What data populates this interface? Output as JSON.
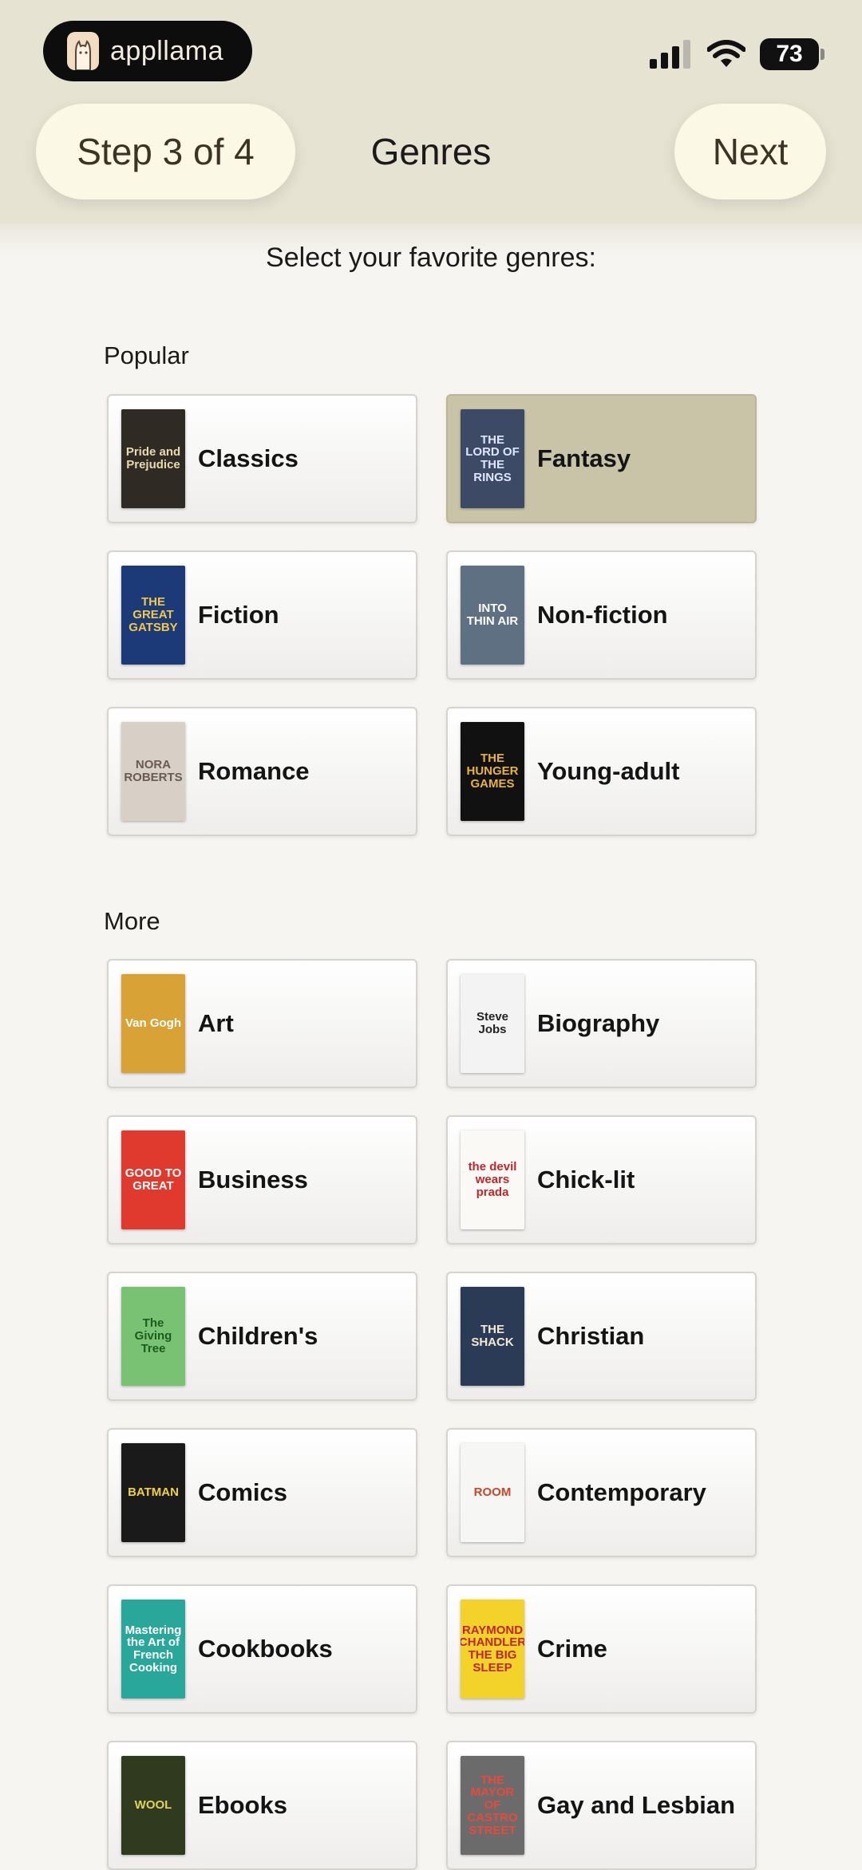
{
  "app": {
    "logo_text": "appllama"
  },
  "status": {
    "battery": "73"
  },
  "header": {
    "step": "Step 3 of 4",
    "title": "Genres",
    "next": "Next"
  },
  "subtitle": "Select your favorite genres:",
  "sections": {
    "popular": {
      "label": "Popular",
      "items": [
        {
          "label": "Classics",
          "cover_text": "Pride and Prejudice",
          "bg": "#2f2a24",
          "fg": "#e8d9b0",
          "selected": false
        },
        {
          "label": "Fantasy",
          "cover_text": "THE LORD OF THE RINGS",
          "bg": "#3c4a66",
          "fg": "#dfe6ff",
          "selected": true
        },
        {
          "label": "Fiction",
          "cover_text": "THE GREAT GATSBY",
          "bg": "#1d3a78",
          "fg": "#f2c84a",
          "selected": false
        },
        {
          "label": "Non-fiction",
          "cover_text": "INTO THIN AIR",
          "bg": "#5e7081",
          "fg": "#ffffff",
          "selected": false
        },
        {
          "label": "Romance",
          "cover_text": "NORA ROBERTS",
          "bg": "#d8cfc6",
          "fg": "#6a5a52",
          "selected": false
        },
        {
          "label": "Young-adult",
          "cover_text": "THE HUNGER GAMES",
          "bg": "#111111",
          "fg": "#e8b33a",
          "selected": false
        }
      ]
    },
    "more": {
      "label": "More",
      "items": [
        {
          "label": "Art",
          "cover_text": "Van Gogh",
          "bg": "#d9a236",
          "fg": "#ffffff",
          "selected": false
        },
        {
          "label": "Biography",
          "cover_text": "Steve Jobs",
          "bg": "#f3f3f3",
          "fg": "#222222",
          "selected": false
        },
        {
          "label": "Business",
          "cover_text": "GOOD TO GREAT",
          "bg": "#e03a2e",
          "fg": "#ffffff",
          "selected": false
        },
        {
          "label": "Chick-lit",
          "cover_text": "the devil wears prada",
          "bg": "#fbf9f6",
          "fg": "#c0262b",
          "selected": false
        },
        {
          "label": "Children's",
          "cover_text": "The Giving Tree",
          "bg": "#79c274",
          "fg": "#1f5a1f",
          "selected": false
        },
        {
          "label": "Christian",
          "cover_text": "THE SHACK",
          "bg": "#2b3a55",
          "fg": "#f4e9d6",
          "selected": false
        },
        {
          "label": "Comics",
          "cover_text": "BATMAN",
          "bg": "#1a1a1a",
          "fg": "#f1d03b",
          "selected": false
        },
        {
          "label": "Contemporary",
          "cover_text": "ROOM",
          "bg": "#f6f6f4",
          "fg": "#c9462b",
          "selected": false
        },
        {
          "label": "Cookbooks",
          "cover_text": "Mastering the Art of French Cooking",
          "bg": "#2aa79b",
          "fg": "#ffffff",
          "selected": false
        },
        {
          "label": "Crime",
          "cover_text": "RAYMOND CHANDLER THE BIG SLEEP",
          "bg": "#f3d22a",
          "fg": "#c0262b",
          "selected": false
        },
        {
          "label": "Ebooks",
          "cover_text": "WOOL",
          "bg": "#2f3a1f",
          "fg": "#e0d25a",
          "selected": false
        },
        {
          "label": "Gay and Lesbian",
          "cover_text": "THE MAYOR OF CASTRO STREET",
          "bg": "#6b6b6b",
          "fg": "#e84a3c",
          "selected": false
        }
      ]
    }
  }
}
